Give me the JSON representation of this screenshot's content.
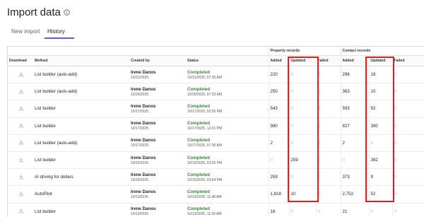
{
  "page": {
    "title": "Import data",
    "info_icon": "info-icon"
  },
  "tabs": [
    {
      "label": "New import",
      "active": false
    },
    {
      "label": "History",
      "active": true
    }
  ],
  "colors": {
    "accent": "#6a5acd",
    "status_completed": "#2e8b3d",
    "highlight": "#e01e1e"
  },
  "table": {
    "group_headers": {
      "property": "Property records",
      "contact": "Contact records"
    },
    "columns": {
      "download": "Download",
      "method": "Method",
      "created_by": "Created by",
      "status": "Status",
      "p_added": "Added",
      "p_updated": "Updated",
      "p_failed": "Failed",
      "c_added": "Added",
      "c_updated": "Updated",
      "c_failed": "Failed"
    },
    "rows": [
      {
        "method": "List builder (auto-add)",
        "creator": "Irene Danos",
        "created": "10/21/2025",
        "status": "Completed",
        "status_time": "10/21/2025, 07:30 AM",
        "p_added": "220",
        "p_updated": "0",
        "p_failed": "0",
        "c_added": "296",
        "c_updated": "18",
        "c_failed": "0"
      },
      {
        "method": "List builder (auto-add)",
        "creator": "Irene Danos",
        "created": "10/20/2025",
        "status": "Completed",
        "status_time": "10/20/2025, 07:33 AM",
        "p_added": "250",
        "p_updated": "0",
        "p_failed": "0",
        "c_added": "363",
        "c_updated": "10",
        "c_failed": "0"
      },
      {
        "method": "List builder",
        "creator": "Irene Danos",
        "created": "10/17/2025",
        "status": "Completed",
        "status_time": "10/17/2025, 03:55 PM",
        "p_added": "543",
        "p_updated": "0",
        "p_failed": "0",
        "c_added": "593",
        "c_updated": "92",
        "c_failed": "0"
      },
      {
        "method": "List builder",
        "creator": "Irene Danos",
        "created": "10/17/2025",
        "status": "Completed",
        "status_time": "10/17/2025, 12:21 PM",
        "p_added": "980",
        "p_updated": "0",
        "p_failed": "0",
        "c_added": "827",
        "c_updated": "390",
        "c_failed": "0"
      },
      {
        "method": "List builder (auto-add)",
        "creator": "Irene Danos",
        "created": "10/17/2025",
        "status": "Completed",
        "status_time": "10/17/2025, 07:30 AM",
        "p_added": "2",
        "p_updated": "0",
        "p_failed": "0",
        "c_added": "2",
        "c_updated": "0",
        "c_failed": "0"
      },
      {
        "method": "List builder",
        "creator": "Irene Danos",
        "created": "10/15/2025",
        "status": "Completed",
        "status_time": "10/15/2025, 03:55 PM",
        "p_added": "0",
        "p_updated": "259",
        "p_failed": "0",
        "c_added": "0",
        "c_updated": "382",
        "c_failed": "0"
      },
      {
        "method": "AI driving for dollars",
        "creator": "Irene Danos",
        "created": "10/15/2025",
        "status": "Completed",
        "status_time": "10/15/2025, 03:54 PM",
        "p_added": "259",
        "p_updated": "0",
        "p_failed": "0",
        "c_added": "373",
        "c_updated": "9",
        "c_failed": "0"
      },
      {
        "method": "AutoPilot",
        "creator": "Irene Danos",
        "created": "10/13/2025",
        "status": "Completed",
        "status_time": "10/13/2025, 11:48 AM",
        "p_added": "1,818",
        "p_updated": "10",
        "p_failed": "0",
        "c_added": "2,752",
        "c_updated": "52",
        "c_failed": "0"
      },
      {
        "method": "List builder",
        "creator": "Irene Danos",
        "created": "10/13/2025",
        "status": "Completed",
        "status_time": "10/13/2025, 11:30 AM",
        "p_added": "16",
        "p_updated": "0",
        "p_failed": "0",
        "c_added": "21",
        "c_updated": "0",
        "c_failed": "0"
      }
    ]
  }
}
